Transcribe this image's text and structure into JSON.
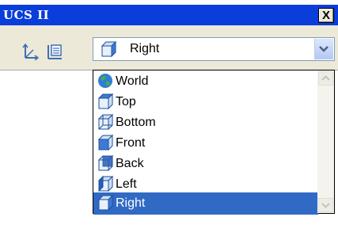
{
  "window": {
    "title": "UCS II",
    "close_label": "X"
  },
  "toolbar": {
    "icons": [
      "ucs-axis-icon",
      "named-ucs-icon"
    ],
    "selected_view": "Right",
    "dropdown_arrow_icon": "chevron-down-icon"
  },
  "dropdown": {
    "items": [
      {
        "label": "World",
        "icon": "globe-icon"
      },
      {
        "label": "Top",
        "icon": "cube-top-icon"
      },
      {
        "label": "Bottom",
        "icon": "cube-bottom-icon"
      },
      {
        "label": "Front",
        "icon": "cube-front-icon"
      },
      {
        "label": "Back",
        "icon": "cube-back-icon"
      },
      {
        "label": "Left",
        "icon": "cube-left-icon"
      },
      {
        "label": "Right",
        "icon": "cube-right-icon"
      }
    ],
    "selected": "Right"
  },
  "colors": {
    "title_bar": "#0a3edb",
    "selection": "#316ac5",
    "toolbar_bg": "#ece9d8"
  }
}
